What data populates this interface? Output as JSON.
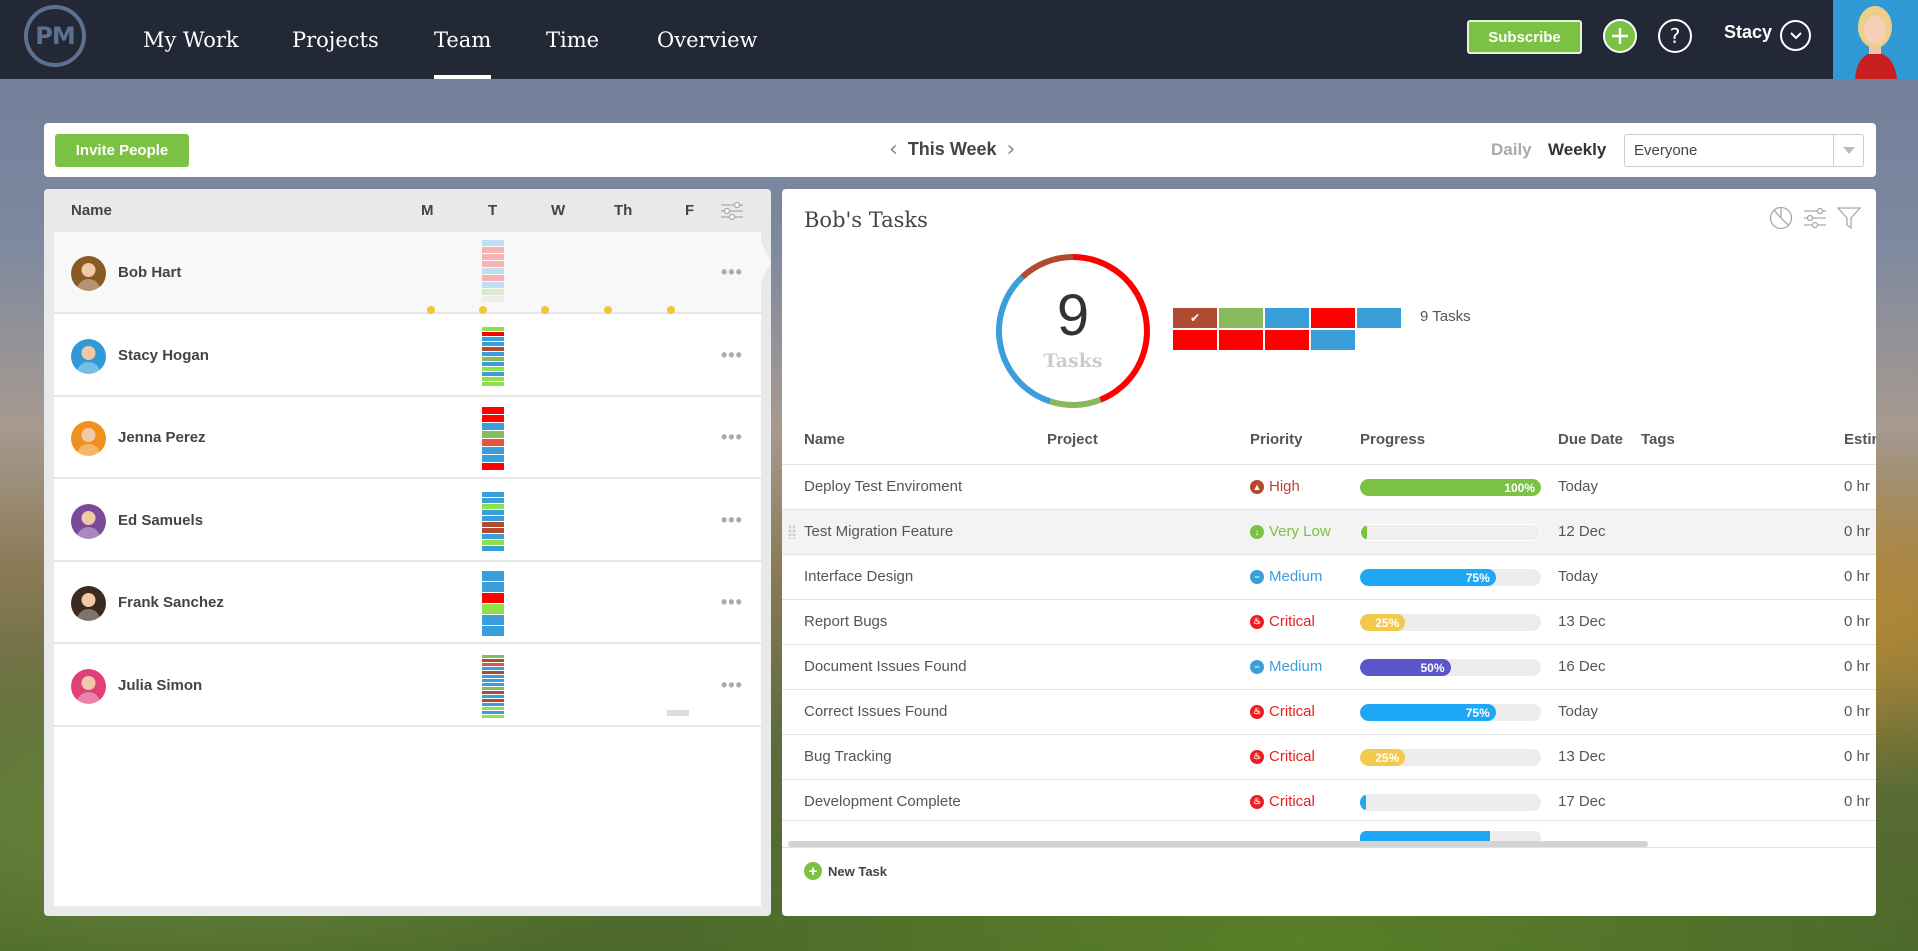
{
  "app": {
    "logo_text": "PM"
  },
  "nav": {
    "items": [
      {
        "label": "My Work",
        "active": false
      },
      {
        "label": "Projects",
        "active": false
      },
      {
        "label": "Team",
        "active": true
      },
      {
        "label": "Time",
        "active": false
      },
      {
        "label": "Overview",
        "active": false
      }
    ],
    "subscribe_label": "Subscribe",
    "user_name": "Stacy",
    "icons": {
      "add": "plus-circle-icon",
      "help": "question-circle-icon",
      "user_menu": "chevron-down-circle-icon"
    }
  },
  "toolbar": {
    "invite_label": "Invite People",
    "period_label": "This Week",
    "view_daily": "Daily",
    "view_weekly": "Weekly",
    "active_view": "Weekly",
    "people_filter": {
      "selected": "Everyone"
    }
  },
  "team": {
    "headers": {
      "name": "Name",
      "days": [
        "M",
        "T",
        "W",
        "Th",
        "F"
      ]
    },
    "members": [
      {
        "name": "Bob Hart",
        "selected": true,
        "avatar_color": "#8a5a24",
        "workload_colors": [
          "#bfe0f2",
          "#f7b3b3",
          "#f7b3b3",
          "#f7b3b3",
          "#bfe0f2",
          "#f7b3b3",
          "#bfe0f2",
          "#d9ebcc",
          "#eeeeee"
        ],
        "day_markers": [
          "M",
          "T",
          "W",
          "Th",
          "F"
        ]
      },
      {
        "name": "Stacy Hogan",
        "selected": false,
        "avatar_color": "#2f9ad6",
        "workload_colors": [
          "#8fe04a",
          "#ff0000",
          "#3a9fd9",
          "#3a9fd9",
          "#b04a30",
          "#3a9fd9",
          "#8ab85c",
          "#3a9fd9",
          "#8fe04a",
          "#3a9fd9",
          "#8fe04a",
          "#8fe04a"
        ]
      },
      {
        "name": "Jenna Perez",
        "selected": false,
        "avatar_color": "#f0901e",
        "workload_colors": [
          "#ff0000",
          "#ff0000",
          "#3a9fd9",
          "#8ab85c",
          "#e8553f",
          "#3a9fd9",
          "#3a9fd9",
          "#ff0000"
        ]
      },
      {
        "name": "Ed Samuels",
        "selected": false,
        "avatar_color": "#7b4a9a",
        "workload_colors": [
          "#3a9fd9",
          "#3a9fd9",
          "#8fe04a",
          "#3a9fd9",
          "#3a9fd9",
          "#b04a30",
          "#b04a30",
          "#3a9fd9",
          "#8fe04a",
          "#3a9fd9"
        ]
      },
      {
        "name": "Frank Sanchez",
        "selected": false,
        "avatar_color": "#3a2a20",
        "workload_colors": [
          "#3a9fd9",
          "#3a9fd9",
          "#ff0000",
          "#8fe04a",
          "#3a9fd9",
          "#3a9fd9"
        ]
      },
      {
        "name": "Julia Simon",
        "selected": false,
        "avatar_color": "#e0407a",
        "workload_colors": [
          "#8ab85c",
          "#b04a30",
          "#e8553f",
          "#3a9fd9",
          "#b04a30",
          "#3a9fd9",
          "#3a9fd9",
          "#3a9fd9",
          "#8ab85c",
          "#b04a30",
          "#3a9fd9",
          "#b04a30",
          "#3a9fd9",
          "#8fe04a",
          "#3a9fd9",
          "#8fe04a"
        ]
      }
    ]
  },
  "tasks_panel": {
    "title": "Bob's Tasks",
    "summary": {
      "count": "9",
      "count_label": "Tasks",
      "legend_label": "9 Tasks",
      "ring_segments": [
        {
          "color": "#ff0000",
          "fraction": 0.44
        },
        {
          "color": "#8ab85c",
          "fraction": 0.11
        },
        {
          "color": "#3a9fd9",
          "fraction": 0.33
        },
        {
          "color": "#b04a30",
          "fraction": 0.12
        }
      ],
      "legend_tiles": [
        {
          "color": "#b04a30",
          "checked": true
        },
        {
          "color": "#8ab85c",
          "checked": false
        },
        {
          "color": "#3a9fd9",
          "checked": false
        },
        {
          "color": "#ff0000",
          "checked": false
        },
        {
          "color": "#3a9fd9",
          "checked": false
        },
        {
          "color": "#ff0000",
          "checked": false
        },
        {
          "color": "#ff0000",
          "checked": false
        },
        {
          "color": "#ff0000",
          "checked": false
        },
        {
          "color": "#3a9fd9",
          "checked": false
        }
      ]
    },
    "columns": [
      "Name",
      "Project",
      "Priority",
      "Progress",
      "Due Date",
      "Tags",
      "Estim"
    ],
    "rows": [
      {
        "name": "Deploy Test Enviroment",
        "project": "",
        "priority": "High",
        "progress": 100,
        "progress_label": "100%",
        "progress_color": "#7bc143",
        "due": "Today",
        "tags": "",
        "estimate": "0 hr"
      },
      {
        "name": "Test Migration Feature",
        "project": "",
        "priority": "Very Low",
        "progress": 0,
        "progress_label": "",
        "progress_color": "#7bc143",
        "due": "12 Dec",
        "tags": "",
        "estimate": "0 hr",
        "hovered": true
      },
      {
        "name": "Interface Design",
        "project": "",
        "priority": "Medium",
        "progress": 75,
        "progress_label": "75%",
        "progress_color": "#1da7f5",
        "due": "Today",
        "tags": "",
        "estimate": "0 hr"
      },
      {
        "name": "Report Bugs",
        "project": "",
        "priority": "Critical",
        "progress": 25,
        "progress_label": "25%",
        "progress_color": "#f2c94c",
        "due": "13 Dec",
        "tags": "",
        "estimate": "0 hr"
      },
      {
        "name": "Document Issues Found",
        "project": "",
        "priority": "Medium",
        "progress": 50,
        "progress_label": "50%",
        "progress_color": "#5a55c9",
        "due": "16 Dec",
        "tags": "",
        "estimate": "0 hr"
      },
      {
        "name": "Correct Issues Found",
        "project": "",
        "priority": "Critical",
        "progress": 75,
        "progress_label": "75%",
        "progress_color": "#1da7f5",
        "due": "Today",
        "tags": "",
        "estimate": "0 hr"
      },
      {
        "name": "Bug Tracking",
        "project": "",
        "priority": "Critical",
        "progress": 25,
        "progress_label": "25%",
        "progress_color": "#f2c94c",
        "due": "13 Dec",
        "tags": "",
        "estimate": "0 hr"
      },
      {
        "name": "Development Complete",
        "project": "",
        "priority": "Critical",
        "progress": 0,
        "progress_label": "",
        "progress_color": "#1da7f5",
        "due": "17 Dec",
        "tags": "",
        "estimate": "0 hr"
      }
    ],
    "priority_styles": {
      "High": {
        "color": "#b8472f",
        "glyph": "▲"
      },
      "Very Low": {
        "color": "#7bc143",
        "glyph": "↓"
      },
      "Medium": {
        "color": "#3a9fd9",
        "glyph": "−"
      },
      "Critical": {
        "color": "#ee1c1c",
        "glyph": "♨"
      }
    },
    "new_task_label": "New Task"
  }
}
